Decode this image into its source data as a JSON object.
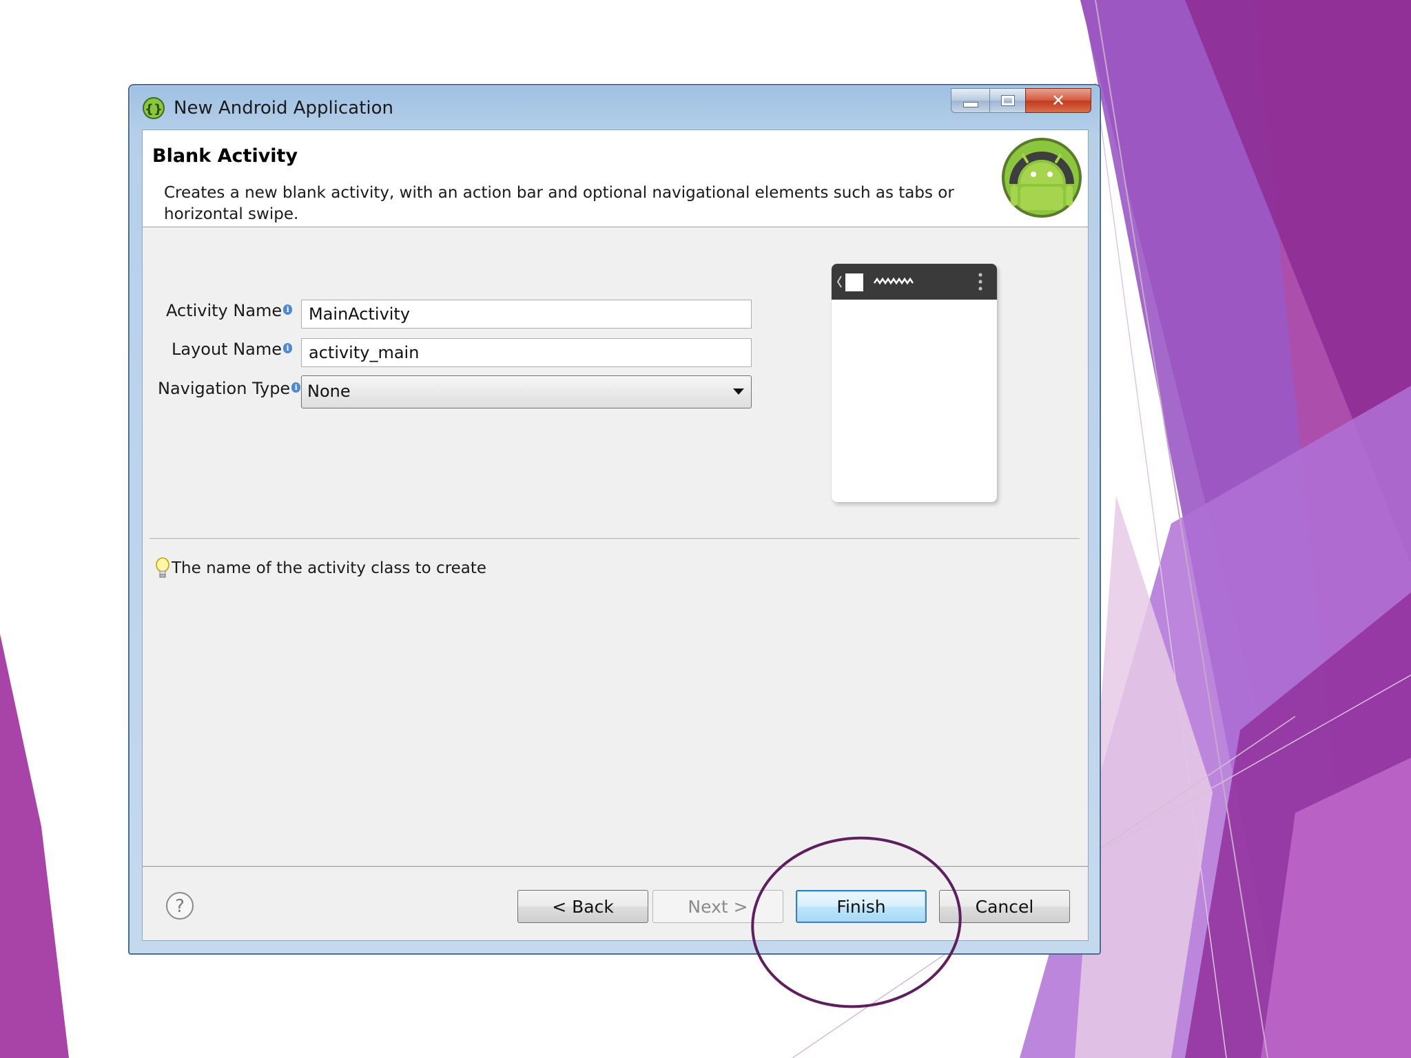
{
  "window": {
    "title": "New Android Application"
  },
  "header": {
    "title": "Blank Activity",
    "description": "Creates a new blank activity, with an action bar and optional navigational elements such as tabs or horizontal swipe."
  },
  "form": {
    "activity_name": {
      "label": "Activity Name",
      "value": "MainActivity"
    },
    "layout_name": {
      "label": "Layout Name",
      "value": "activity_main"
    },
    "navigation_type": {
      "label": "Navigation Type",
      "selected": "None"
    }
  },
  "hint": {
    "text": "The name of the activity class to create"
  },
  "buttons": {
    "back": "< Back",
    "next": "Next >",
    "finish": "Finish",
    "cancel": "Cancel"
  },
  "icons": {
    "app": "android-app-icon",
    "logo": "android-logo-icon",
    "info": "info-icon",
    "hint": "lightbulb-icon",
    "help": "help-icon",
    "dropdown": "chevron-down-icon"
  },
  "colors": {
    "slide_purple": "#9b3a9e",
    "highlight_ellipse": "#5e1f5f",
    "android_green": "#8cc63f"
  }
}
